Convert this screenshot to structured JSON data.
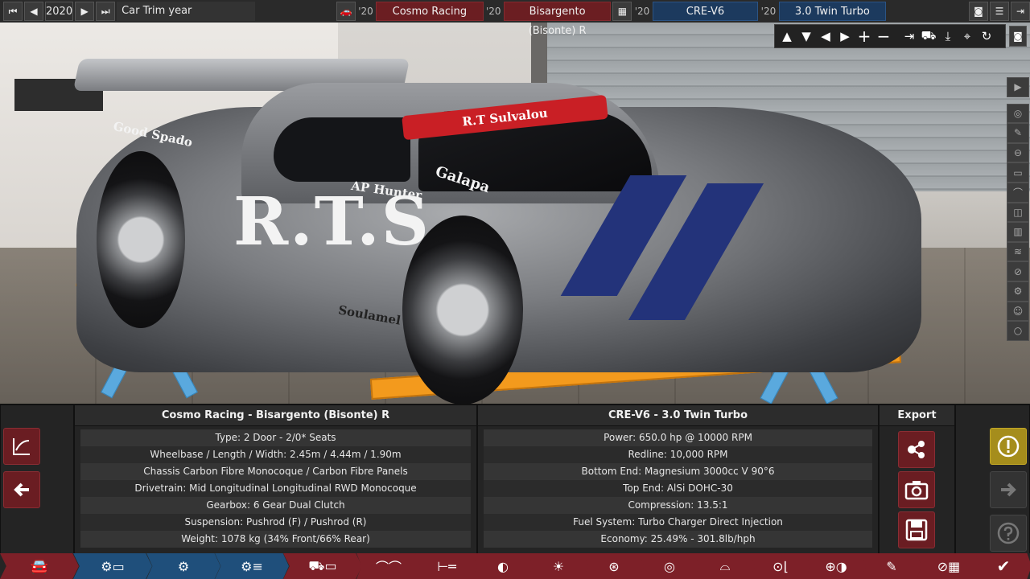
{
  "topbar": {
    "year": "2020",
    "trim_label": "Car Trim year",
    "model_year": "'20",
    "family_name": "Cosmo Racing",
    "trim_year": "'20",
    "trim_name": "Bisargento (Bisonte) R",
    "engine_family_year": "'20",
    "engine_family": "CRE-V6",
    "engine_variant_year": "'20",
    "engine_variant": "3.0 Twin Turbo"
  },
  "scene": {
    "banner": "R.T Sulvalou",
    "sponsor_big": "R.T.S",
    "sponsor_1": "Good Spado",
    "sponsor_2": "AP Hunter",
    "sponsor_3": "Galapa",
    "sponsor_4": "Soulamel",
    "colors": {
      "body": "#8a8c90",
      "stripe": "#23337a",
      "banner": "#c91f25",
      "lift": "#f39a1d"
    }
  },
  "car_panel": {
    "title": "Cosmo Racing - Bisargento (Bisonte) R",
    "rows": [
      "Type: 2 Door - 2/0* Seats",
      "Wheelbase / Length / Width: 2.45m / 4.44m / 1.90m",
      "Chassis Carbon Fibre Monocoque / Carbon Fibre Panels",
      "Drivetrain: Mid Longitudinal Longitudinal RWD Monocoque",
      "Gearbox: 6 Gear Dual Clutch",
      "Suspension: Pushrod (F) / Pushrod (R)",
      "Weight: 1078 kg (34% Front/66% Rear)"
    ]
  },
  "engine_panel": {
    "title": "CRE-V6 - 3.0 Twin Turbo",
    "rows": [
      "Power: 650.0 hp @ 10000 RPM",
      "Redline:  10,000 RPM",
      "Bottom End: Magnesium 3000cc V 90°6",
      "Top End: AlSi DOHC-30",
      "Compression: 13.5:1",
      "Fuel System: Turbo Charger Direct Injection",
      "Economy: 25.49% - 301.8lb/hph"
    ]
  },
  "export_panel": {
    "title": "Export"
  },
  "icons": {
    "first": "first-icon",
    "prev": "prev-icon",
    "next": "next-icon",
    "last": "last-icon",
    "share": "share-icon",
    "camera": "camera-icon",
    "save": "save-icon",
    "warning": "warning-icon",
    "arrow_right": "arrow-right-icon",
    "help": "help-icon",
    "back": "back-arrow-icon",
    "graph": "graph-icon"
  }
}
